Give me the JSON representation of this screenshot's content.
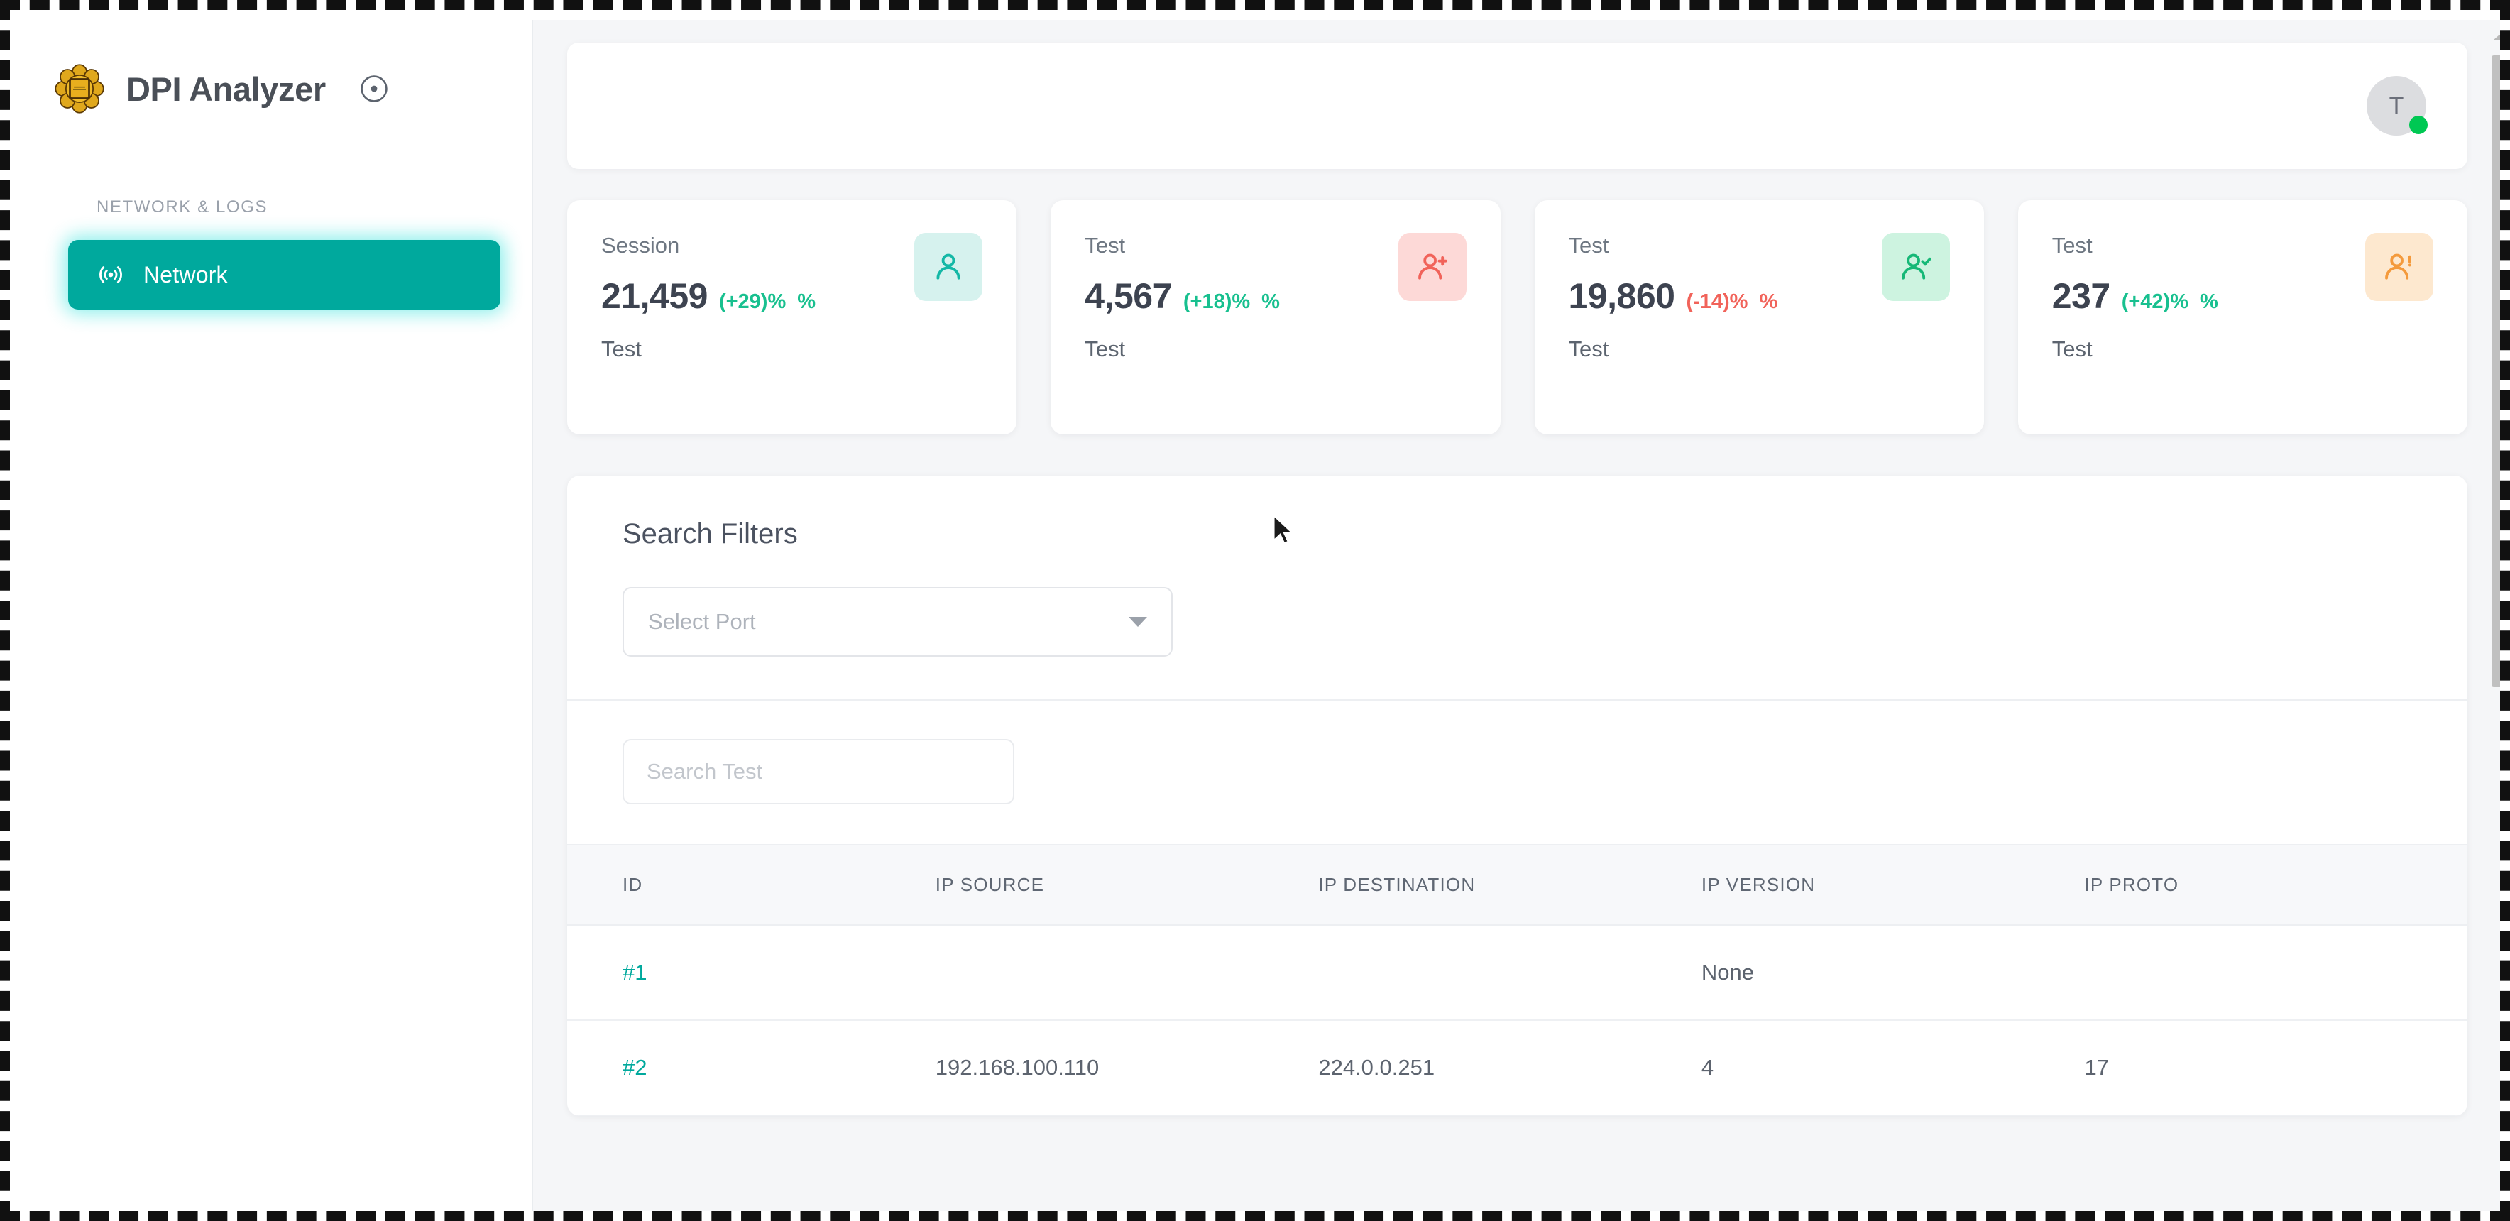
{
  "brand": {
    "title": "DPI Analyzer",
    "logo_icon": "flower-rosette-logo-icon",
    "toggle_icon": "circle-dot-icon"
  },
  "sidebar": {
    "section_label": "NETWORK & LOGS",
    "items": [
      {
        "label": "Network",
        "icon": "broadcast-signal-icon",
        "active": true
      }
    ]
  },
  "topbar": {
    "avatar_initial": "T",
    "status": "online",
    "status_color": "#00c853"
  },
  "cards": [
    {
      "label": "Session",
      "value": "21,459",
      "delta": "(+29)%",
      "delta_dir": "up",
      "sub": "Test",
      "icon": "user-icon",
      "icon_bg": "#d6f2ee",
      "icon_color": "#15b8a6"
    },
    {
      "label": "Test",
      "value": "4,567",
      "delta": "(+18)%",
      "delta_dir": "up",
      "sub": "Test",
      "icon": "user-plus-icon",
      "icon_bg": "#fdd9d7",
      "icon_color": "#f1635a"
    },
    {
      "label": "Test",
      "value": "19,860",
      "delta": "(-14)%",
      "delta_dir": "down",
      "sub": "Test",
      "icon": "user-check-icon",
      "icon_bg": "#cdf3e0",
      "icon_color": "#16b877"
    },
    {
      "label": "Test",
      "value": "237",
      "delta": "(+42)%",
      "delta_dir": "up",
      "sub": "Test",
      "icon": "user-alert-icon",
      "icon_bg": "#fde8cf",
      "icon_color": "#f49a3c"
    }
  ],
  "filters": {
    "title": "Search Filters",
    "port_select": {
      "value": "Select Port",
      "caret_icon": "chevron-down-icon"
    },
    "search": {
      "value": "",
      "placeholder": "Search Test"
    }
  },
  "table": {
    "columns": [
      "ID",
      "IP SOURCE",
      "IP DESTINATION",
      "IP VERSION",
      "IP PROTO"
    ],
    "rows": [
      {
        "id": "#1",
        "ip_source": "",
        "ip_destination": "",
        "ip_version": "None",
        "ip_proto": ""
      },
      {
        "id": "#2",
        "ip_source": "192.168.100.110",
        "ip_destination": "224.0.0.251",
        "ip_version": "4",
        "ip_proto": "17"
      }
    ]
  },
  "theme": {
    "accent": "#00a99d",
    "positive": "#18c08f",
    "negative": "#f1635a",
    "page_bg": "#f5f6f8"
  }
}
